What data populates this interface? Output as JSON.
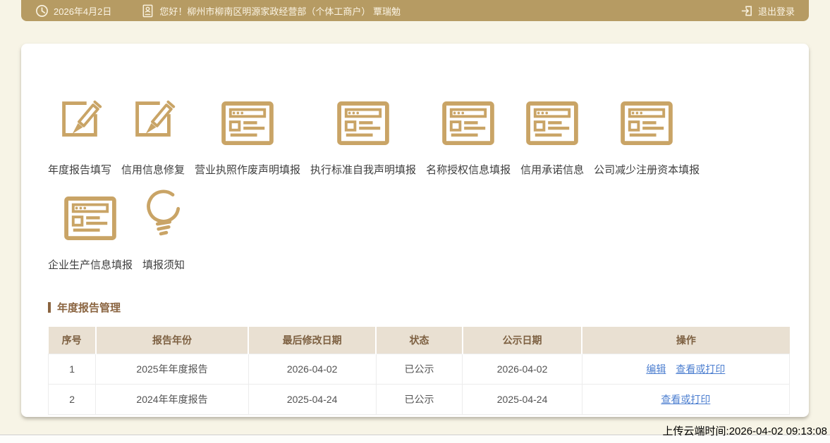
{
  "topbar": {
    "date": "2026年4月2日",
    "greeting": "您好！柳州市柳南区明源家政经营部（个体工商户） 覃瑞勉",
    "logout_label": "退出登录"
  },
  "shortcut_rows": [
    [
      {
        "label": "年度报告填写",
        "icon": "edit-icon"
      },
      {
        "label": "信用信息修复",
        "icon": "edit-icon"
      },
      {
        "label": "营业执照作废声明填报",
        "icon": "form-icon"
      },
      {
        "label": "执行标准自我声明填报",
        "icon": "form-icon"
      },
      {
        "label": "名称授权信息填报",
        "icon": "form-icon"
      },
      {
        "label": "信用承诺信息",
        "icon": "form-icon"
      },
      {
        "label": "公司减少注册资本填报",
        "icon": "form-icon"
      }
    ],
    [
      {
        "label": "企业生产信息填报",
        "icon": "form-icon"
      },
      {
        "label": "填报须知",
        "icon": "bulb-icon"
      }
    ]
  ],
  "report_section": {
    "title": "年度报告管理",
    "table": {
      "headers": [
        "序号",
        "报告年份",
        "最后修改日期",
        "状态",
        "公示日期",
        "操作"
      ],
      "col_widths": [
        "6.4%",
        "20.6%",
        "17.2%",
        "11.7%",
        "16.1%",
        "28%"
      ],
      "rows": [
        {
          "cells": [
            "1",
            "2025年年度报告",
            "2026-04-02",
            "已公示",
            "2026-04-02"
          ],
          "actions": [
            {
              "label": "编辑",
              "name": "edit-link"
            },
            {
              "label": "查看或打印",
              "name": "view-or-print-link"
            }
          ]
        },
        {
          "cells": [
            "2",
            "2024年年度报告",
            "2025-04-24",
            "已公示",
            "2025-04-24"
          ],
          "actions": [
            {
              "label": "查看或打印",
              "name": "view-or-print-link"
            }
          ]
        }
      ]
    }
  },
  "footer": {
    "upload_time": "上传云端时间:2026-04-02 09:13:08"
  },
  "colors": {
    "topbar_bg": "#b69b63",
    "icon_gold": "#c9a466",
    "page_bg": "#f7f4e6",
    "table_header_bg": "#e9e0d2",
    "table_header_text": "#7d6041",
    "section_title": "#8a6440",
    "link_blue": "#4d7fd0"
  }
}
